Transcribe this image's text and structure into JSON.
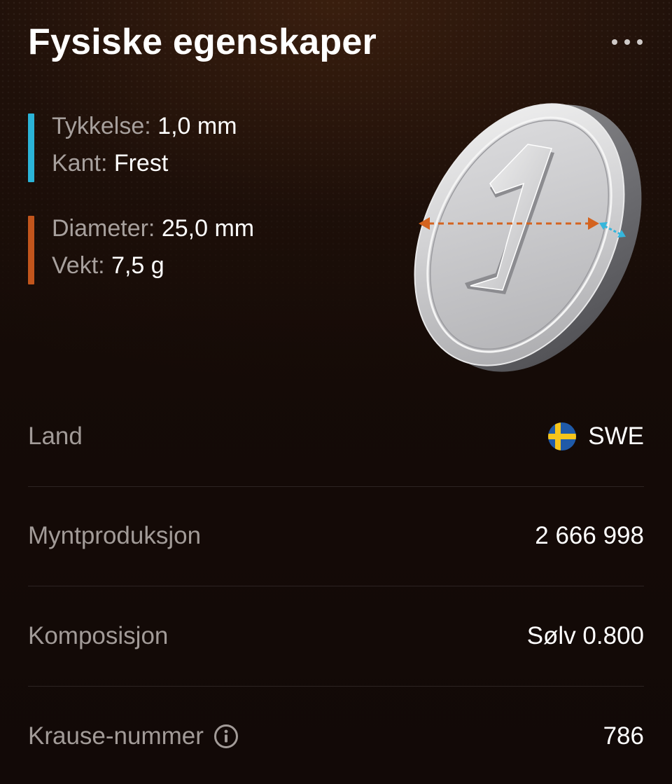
{
  "header": {
    "title": "Fysiske egenskaper",
    "more_icon": "more-horizontal-icon"
  },
  "specs": {
    "edge_group": {
      "color": "#2bb4d8",
      "thickness": {
        "label": "Tykkelse:",
        "value": "1,0 mm"
      },
      "edge": {
        "label": "Kant:",
        "value": "Frest"
      }
    },
    "face_group": {
      "color": "#c2551c",
      "diameter": {
        "label": "Diameter:",
        "value": "25,0 mm"
      },
      "weight": {
        "label": "Vekt:",
        "value": "7,5 g"
      }
    }
  },
  "coin": {
    "face_numeral": "1",
    "diameter_arrow_color": "#d4631f",
    "thickness_arrow_color": "#35b6dc"
  },
  "details": {
    "country": {
      "label": "Land",
      "value": "SWE",
      "flag_icon": "sweden-flag-icon"
    },
    "mintage": {
      "label": "Myntproduksjon",
      "value": "2 666 998"
    },
    "composition": {
      "label": "Komposisjon",
      "value": "Sølv 0.800"
    },
    "krause": {
      "label": "Krause-nummer",
      "value": "786",
      "info_icon": "info-icon"
    }
  }
}
